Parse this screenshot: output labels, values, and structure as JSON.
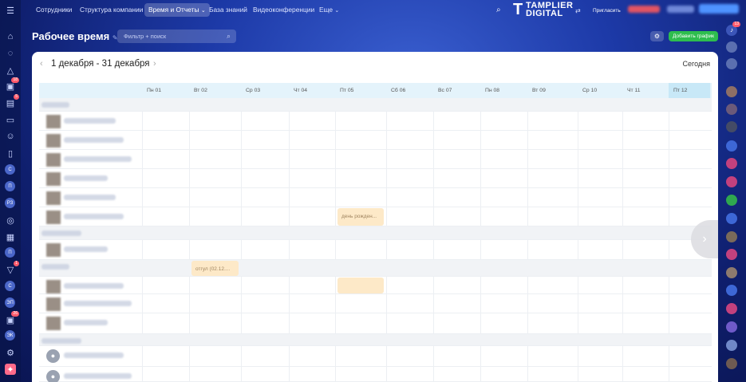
{
  "nav": {
    "menu_icon": "menu-icon",
    "items": [
      "Сотрудники",
      "Структура компании",
      "Время и Отчеты",
      "База знаний",
      "Видеоконференции",
      "Еще"
    ],
    "active_index": 2,
    "caret": "⌄",
    "search_icon": "search-icon",
    "invite": "Пригласить",
    "logo_line1": "TAMPLIER",
    "logo_line2": "DIGITAL",
    "logo_mark": "T"
  },
  "page": {
    "title": "Рабочее время",
    "search_placeholder": "Фильтр + поиск",
    "add_schedule": "Добавить график",
    "gear_icon": "⚙"
  },
  "sidebar_left": {
    "badges": [
      "18",
      "5",
      "1",
      "26"
    ],
    "letters": [
      "С",
      "П",
      "РЗ",
      "П",
      "С",
      "ЭП",
      "ЭК"
    ]
  },
  "calendar": {
    "period": "1 декабря - 31 декабря",
    "today": "Сегодня",
    "prev": "‹",
    "next": "›",
    "days": [
      "Пн 01",
      "Вт 02",
      "Ср 03",
      "Чт 04",
      "Пт 05",
      "Сб 06",
      "Вс 07",
      "Пн 08",
      "Вт 09",
      "Ср 10",
      "Чт 11",
      "Пт 12"
    ],
    "today_index": 11,
    "events": [
      {
        "label": "день рожден...",
        "day_index": 4,
        "row": 6
      },
      {
        "label": "отгул (02.12....",
        "day_index": 1,
        "row": 9
      },
      {
        "label": "",
        "day_index": 4,
        "row": 10
      }
    ]
  },
  "right_badge": "13",
  "colors": {
    "accent_green": "#2ebd4e",
    "event_bg": "#fde9c8",
    "today_col": "#c8e8f7"
  }
}
